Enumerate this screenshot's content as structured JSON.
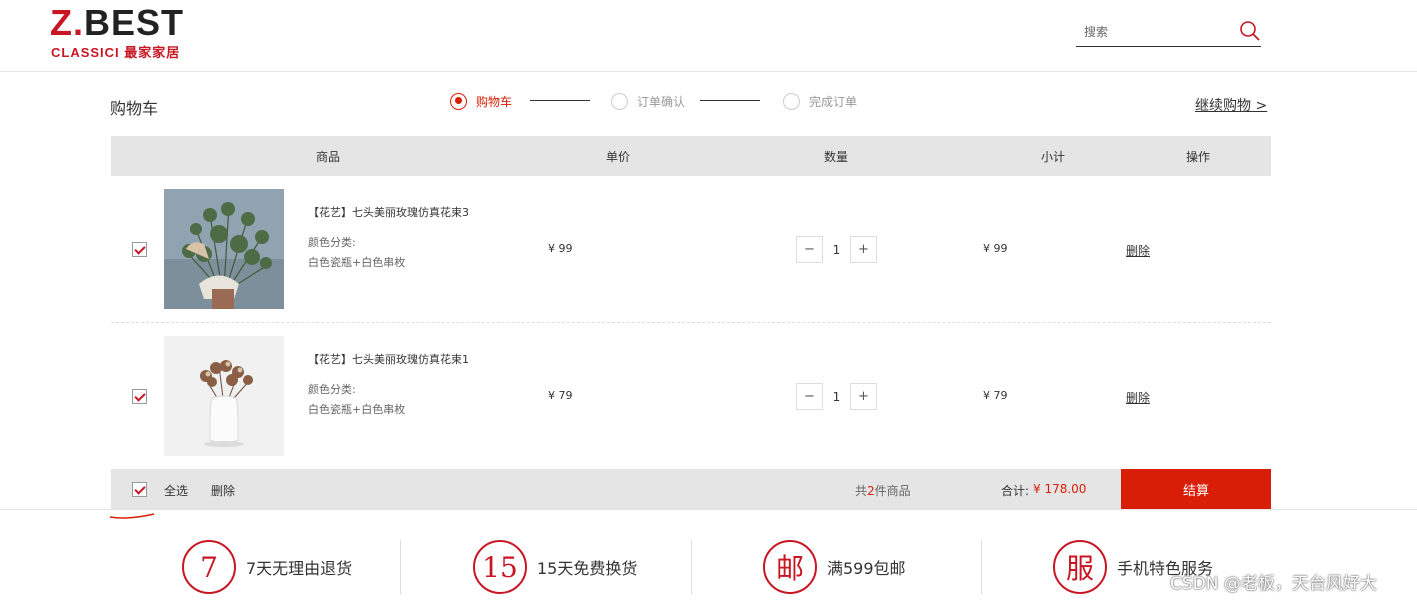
{
  "header": {
    "logo_main_left": "Z.",
    "logo_main_right": "BEST",
    "logo_sub": "CLASSICI 最家家居",
    "search_placeholder": "搜索",
    "search_icon": "search-icon"
  },
  "page": {
    "title": "购物车",
    "continue_label": "继续购物 >"
  },
  "steps": [
    {
      "label": "购物车",
      "active": true
    },
    {
      "label": "订单确认",
      "active": false
    },
    {
      "label": "完成订单",
      "active": false
    }
  ],
  "columns": [
    "商品",
    "单价",
    "数量",
    "小计",
    "操作"
  ],
  "items": [
    {
      "checked": true,
      "name": "【花艺】七头美丽玫瑰仿真花束3",
      "meta_label": "颜色分类:",
      "meta_value": "白色瓷瓶+白色串枚",
      "price": "¥ 99",
      "qty_minus": "−",
      "quantity": "1",
      "qty_plus": "+",
      "subtotal": "¥ 99",
      "delete_label": "删除"
    },
    {
      "checked": true,
      "name": "【花艺】七头美丽玫瑰仿真花束1",
      "meta_label": "颜色分类:",
      "meta_value": "白色瓷瓶+白色串枚",
      "price": "¥ 79",
      "qty_minus": "−",
      "quantity": "1",
      "qty_plus": "+",
      "subtotal": "¥ 79",
      "delete_label": "删除"
    }
  ],
  "footer": {
    "select_all": "全选",
    "delete": "删除",
    "count_prefix": "共",
    "count": "2",
    "count_suffix": "件商品",
    "total_label": "合计:",
    "total": "¥ 178.00",
    "checkout": "结算"
  },
  "services": [
    {
      "badge": "7",
      "text": "7天无理由退货"
    },
    {
      "badge": "15",
      "text": "15天免费换货"
    },
    {
      "badge": "邮",
      "text": "满599包邮"
    },
    {
      "badge": "服",
      "text": "手机特色服务"
    }
  ],
  "watermark": "CSDN @老板，天台风好大",
  "colors": {
    "accent": "#c81623",
    "checkout": "#d81e06",
    "bar_bg": "#e5e5e5"
  }
}
